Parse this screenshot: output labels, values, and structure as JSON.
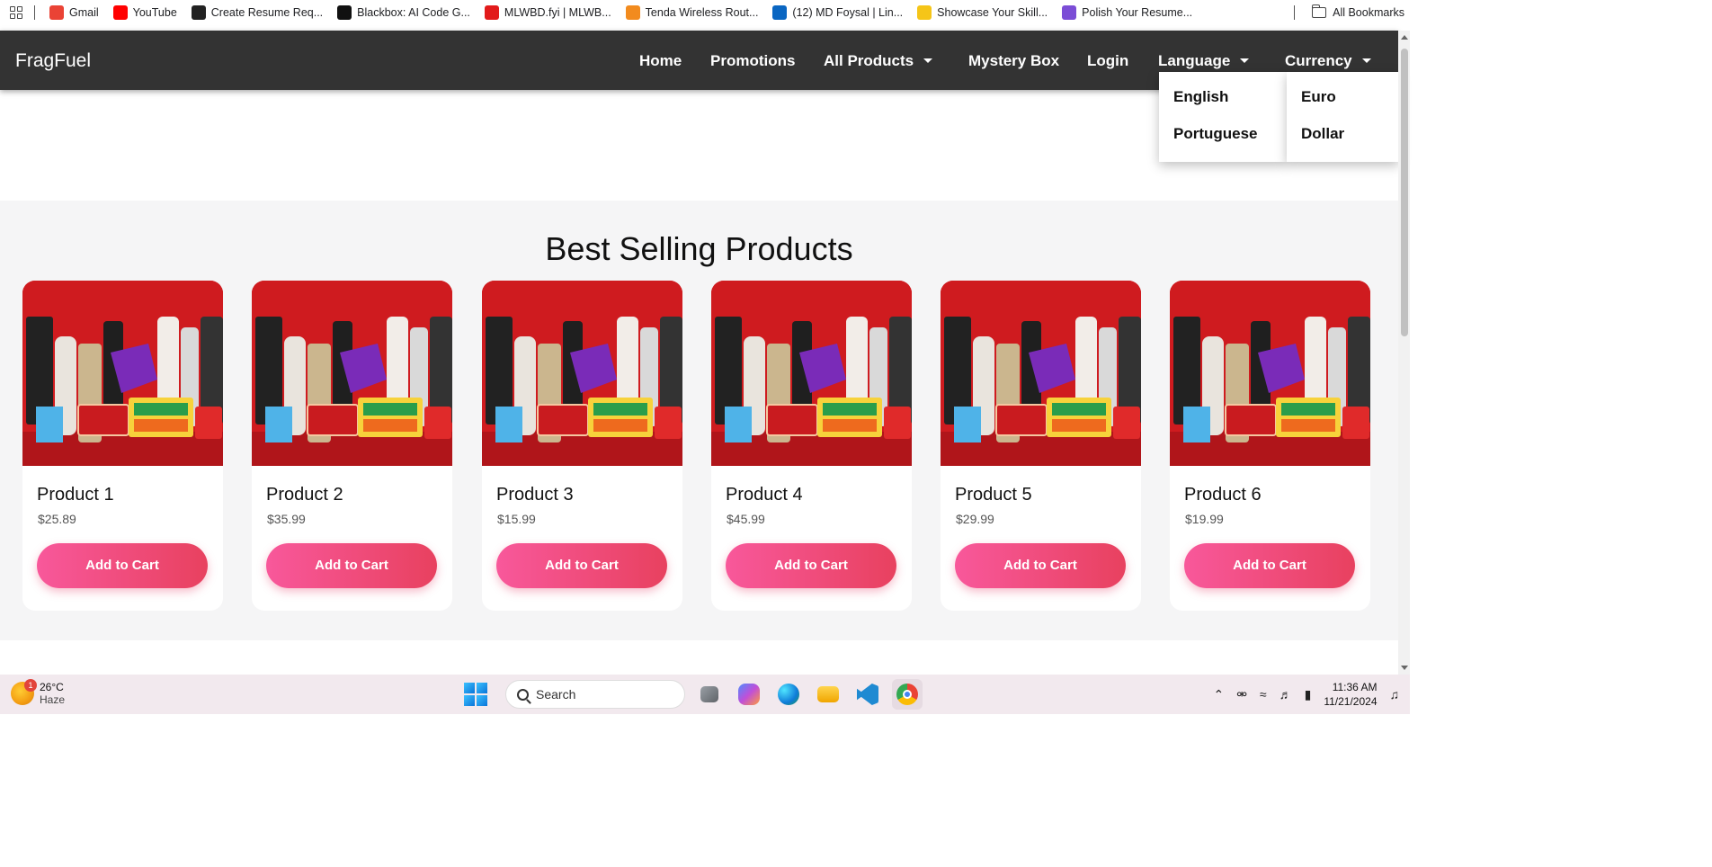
{
  "bookmarks": {
    "items": [
      {
        "label": "Gmail",
        "color": "#ea4335"
      },
      {
        "label": "YouTube",
        "color": "#ff0000"
      },
      {
        "label": "Create Resume Req...",
        "color": "#222222"
      },
      {
        "label": "Blackbox: AI Code G...",
        "color": "#111111"
      },
      {
        "label": "MLWBD.fyi | MLWB...",
        "color": "#e21b1b"
      },
      {
        "label": "Tenda Wireless Rout...",
        "color": "#f28b1e"
      },
      {
        "label": "(12) MD Foysal | Lin...",
        "color": "#0a66c2"
      },
      {
        "label": "Showcase Your Skill...",
        "color": "#f5c518"
      },
      {
        "label": "Polish Your Resume...",
        "color": "#7b4dd6"
      }
    ],
    "all_label": "All Bookmarks"
  },
  "nav": {
    "brand": "FragFuel",
    "home": "Home",
    "promotions": "Promotions",
    "all_products": "All Products",
    "mystery_box": "Mystery Box",
    "login": "Login",
    "language": "Language",
    "currency": "Currency"
  },
  "language_menu": [
    "English",
    "Portuguese"
  ],
  "currency_menu": [
    "Euro",
    "Dollar"
  ],
  "section": {
    "title": "Best Selling Products",
    "products": [
      {
        "name": "Product 1",
        "price": "$25.89",
        "button": "Add to Cart"
      },
      {
        "name": "Product 2",
        "price": "$35.99",
        "button": "Add to Cart"
      },
      {
        "name": "Product 3",
        "price": "$15.99",
        "button": "Add to Cart"
      },
      {
        "name": "Product 4",
        "price": "$45.99",
        "button": "Add to Cart"
      },
      {
        "name": "Product 5",
        "price": "$29.99",
        "button": "Add to Cart"
      },
      {
        "name": "Product 6",
        "price": "$19.99",
        "button": "Add to Cart"
      }
    ]
  },
  "taskbar": {
    "weather_temp": "26°C",
    "weather_desc": "Haze",
    "weather_badge": "1",
    "search_placeholder": "Search",
    "time": "11:36 AM",
    "date": "11/21/2024"
  },
  "colors": {
    "navbar": "#333333",
    "button_start": "#f8589b",
    "button_end": "#e8415f",
    "section_bg": "#f5f5f6"
  }
}
